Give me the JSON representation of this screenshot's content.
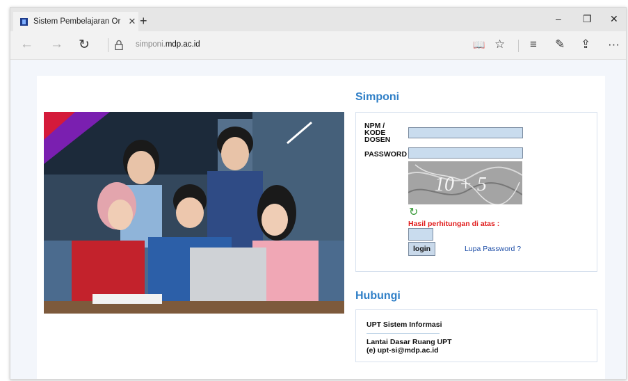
{
  "browser": {
    "tab_title": "Sistem Pembelajaran Or",
    "tab_close": "✕",
    "new_tab": "+",
    "url_prefix": "simponi.",
    "url_domain": "mdp.ac.id",
    "controls": {
      "minimize": "–",
      "maximize": "❐",
      "close": "✕"
    }
  },
  "nav": {
    "back": "←",
    "forward": "→",
    "refresh": "↻"
  },
  "toolbar": {
    "reading_view": "📖",
    "favorite": "☆",
    "hub": "≡",
    "notes": "✎",
    "share": "⇪",
    "more": "···"
  },
  "login": {
    "section_title": "Simponi",
    "npm_label": "NPM /\nKODE\nDOSEN",
    "password_label": "PASSWORD",
    "captcha_text": "10 + 5",
    "refresh_icon": "↻",
    "hint": "Hasil perhitungan di atas :",
    "login_button": "login",
    "forgot_link": "Lupa Password ?"
  },
  "contact": {
    "section_title": "Hubungi",
    "line1": "UPT Sistem Informasi",
    "line2": "Lantai Dasar Ruang UPT",
    "line3": "(e) upt-si@mdp.ac.id"
  },
  "colors": {
    "accent": "#2f7fc7",
    "input_bg": "#c9dcee",
    "hint_red": "#e01b1b"
  }
}
